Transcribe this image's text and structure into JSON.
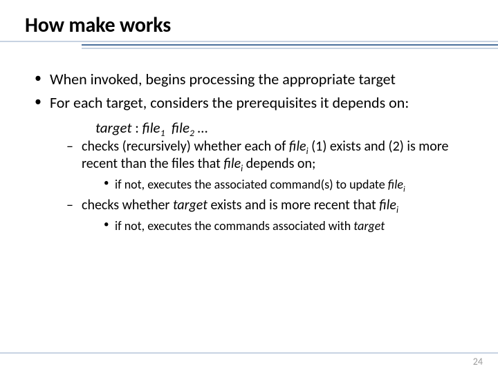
{
  "slide": {
    "title": "How make works",
    "page_number": "24",
    "bullets": {
      "b1": "When invoked, begins processing the appropriate target",
      "b2": "For each target, considers the prerequisites it depends on:"
    },
    "syntax": {
      "target_word": "target",
      "sep": " : ",
      "file_word": "file",
      "sub1": "1",
      "sub2": "2",
      "ellipsis": " …"
    },
    "sub": {
      "s1_pre": "checks (recursively) whether each of ",
      "s1_filei": "file",
      "s1_sub_i": "i",
      "s1_mid": " (1) exists and (2) is more recent than the files that ",
      "s1_post": " depends on;",
      "s1a_pre": "if not, executes the associated command(s) to update ",
      "s2_pre": "checks whether ",
      "s2_target": "target",
      "s2_mid": " exists and is more recent that ",
      "s2a_pre": "if not, executes the commands associated with ",
      "s2a_target": "target"
    }
  }
}
